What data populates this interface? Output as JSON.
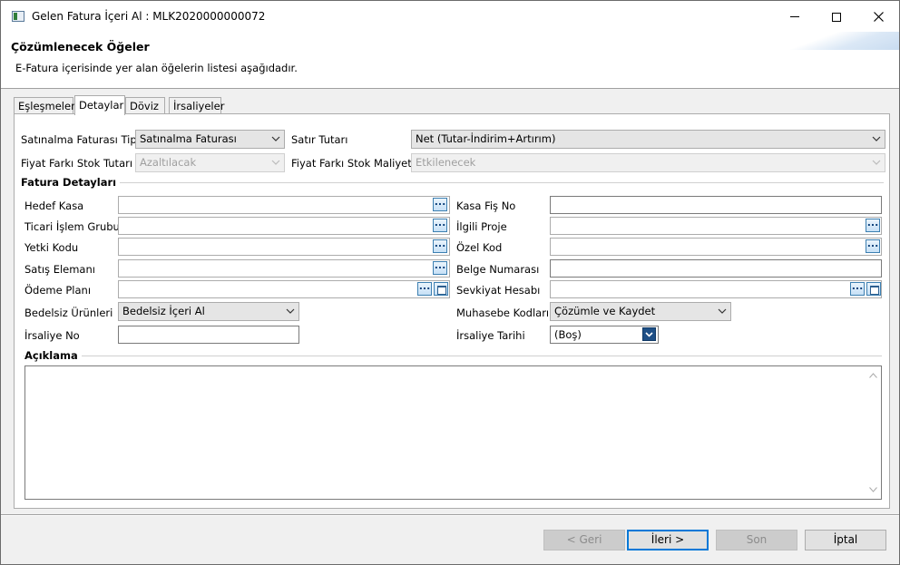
{
  "window": {
    "title": "Gelen Fatura İçeri Al : MLK2020000000072"
  },
  "header": {
    "title": "Çözümlenecek Öğeler",
    "subtitle": "E-Fatura içerisinde yer alan öğelerin listesi aşağıdadır."
  },
  "tabs": [
    {
      "label": "Eşleşmeler",
      "active": false
    },
    {
      "label": "Detaylar",
      "active": true
    },
    {
      "label": "Döviz",
      "active": false
    },
    {
      "label": "İrsaliyeler",
      "active": false
    }
  ],
  "top_fields": {
    "satinalma_faturasi_tipi": {
      "label": "Satınalma Faturası Tipi",
      "value": "Satınalma Faturası"
    },
    "satir_tutari": {
      "label": "Satır Tutarı",
      "value": "Net (Tutar-İndirim+Artırım)"
    },
    "fiyat_farki_stok_tutari": {
      "label": "Fiyat Farkı Stok Tutarı",
      "value": "Azaltılacak"
    },
    "fiyat_farki_stok_maliyeti": {
      "label": "Fiyat Farkı Stok Maliyeti",
      "value": "Etkilenecek"
    }
  },
  "fatura_detaylari": {
    "title": "Fatura Detayları",
    "left": {
      "hedef_kasa": {
        "label": "Hedef Kasa",
        "value": ""
      },
      "ticari_islem_grubu": {
        "label": "Ticari İşlem Grubu",
        "value": ""
      },
      "yetki_kodu": {
        "label": "Yetki Kodu",
        "value": ""
      },
      "satis_elemani": {
        "label": "Satış Elemanı",
        "value": ""
      },
      "odeme_plani": {
        "label": "Ödeme Planı",
        "value": ""
      },
      "bedelsiz_urunleri": {
        "label": "Bedelsiz Ürünleri",
        "value": "Bedelsiz İçeri Al"
      },
      "irsaliye_no": {
        "label": "İrsaliye No",
        "value": ""
      }
    },
    "right": {
      "kasa_fis_no": {
        "label": "Kasa Fiş No",
        "value": ""
      },
      "ilgili_proje": {
        "label": "İlgili Proje",
        "value": ""
      },
      "ozel_kod": {
        "label": "Özel Kod",
        "value": ""
      },
      "belge_numarasi": {
        "label": "Belge Numarası",
        "value": ""
      },
      "sevkiyat_hesabi": {
        "label": "Sevkiyat Hesabı",
        "value": ""
      },
      "muhasebe_kodlari": {
        "label": "Muhasebe Kodları",
        "value": "Çözümle ve Kaydet"
      },
      "irsaliye_tarihi": {
        "label": "İrsaliye Tarihi",
        "value": "(Boş)"
      }
    },
    "ellipsis": "..."
  },
  "aciklama": {
    "title": "Açıklama",
    "value": ""
  },
  "footer": {
    "back": "< Geri",
    "next": "İleri >",
    "finish": "Son",
    "cancel": "İptal"
  },
  "colors": {
    "accent": "#0078d7",
    "panel_bg": "#ffffff",
    "window_bg": "#f0f0f0"
  },
  "icons": [
    "app-window-icon",
    "minimize-icon",
    "maximize-icon",
    "close-icon",
    "chevron-down-icon",
    "ellipsis-icon",
    "calendar-icon",
    "scroll-up-icon",
    "scroll-down-icon"
  ]
}
